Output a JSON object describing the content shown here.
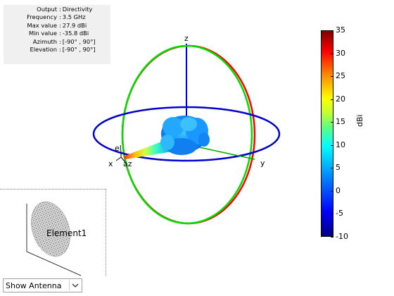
{
  "info_panel": {
    "rows": [
      {
        "label": "Output",
        "value": "Directivity"
      },
      {
        "label": "Frequency",
        "value": "3.5 GHz"
      },
      {
        "label": "Max value",
        "value": "27.9 dBi"
      },
      {
        "label": "Min value",
        "value": "-35.8 dBi"
      },
      {
        "label": "Azimuth",
        "value": "[-90° , 90°]"
      },
      {
        "label": "Elevation",
        "value": "[-90° , 90°]"
      }
    ]
  },
  "plot": {
    "axis_labels": {
      "z": "z",
      "x": "x",
      "y": "y",
      "el": "el",
      "az": "az"
    },
    "colors": {
      "z_axis": "#0000cc",
      "azimuth_ring": "#0000cc",
      "elevation_ring_xz": "#ff0000",
      "elevation_ring_yz": "#00dd00",
      "y_axis": "#00aa00"
    }
  },
  "colorbar": {
    "unit": "dBi",
    "ticks": [
      "35",
      "30",
      "25",
      "20",
      "15",
      "10",
      "5",
      "0",
      "-5",
      "-10"
    ],
    "range": [
      -10,
      35
    ],
    "colormap": "jet"
  },
  "element_panel": {
    "label": "Element1"
  },
  "view_select": {
    "selected": "Show Antenna",
    "arrow_icon": "chevron-down-icon"
  }
}
